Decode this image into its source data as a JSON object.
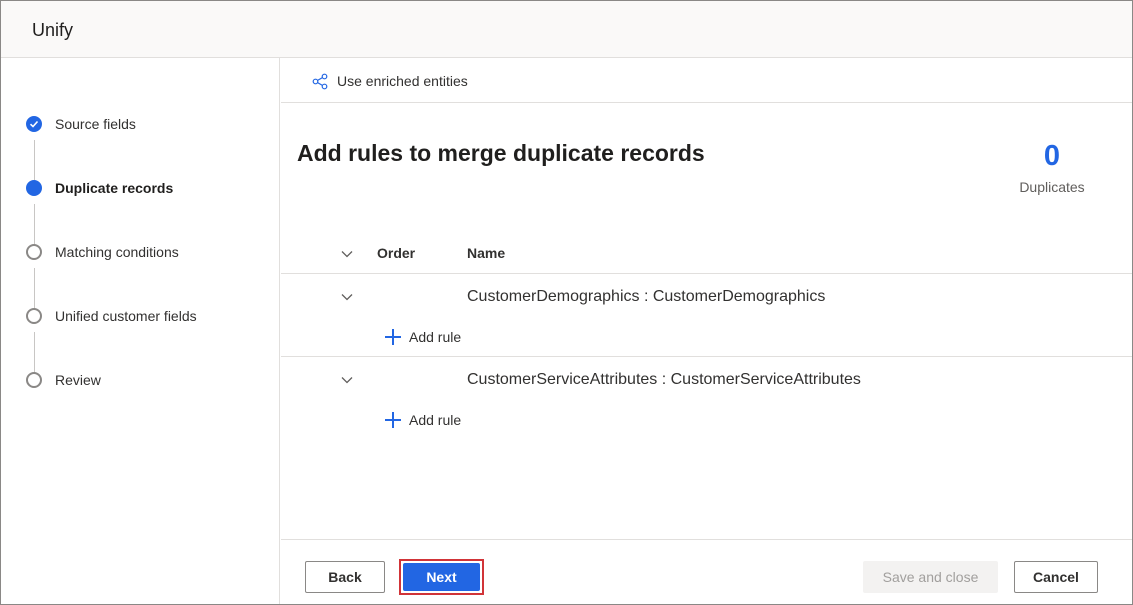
{
  "header": {
    "title": "Unify"
  },
  "steps": [
    {
      "label": "Source fields",
      "state": "done"
    },
    {
      "label": "Duplicate records",
      "state": "current"
    },
    {
      "label": "Matching conditions",
      "state": "todo"
    },
    {
      "label": "Unified customer fields",
      "state": "todo"
    },
    {
      "label": "Review",
      "state": "todo"
    }
  ],
  "cmdbar": {
    "use_enriched_label": "Use enriched entities",
    "icon": "share-nodes-icon"
  },
  "main": {
    "title": "Add rules to merge duplicate records",
    "duplicates_count": "0",
    "duplicates_label": "Duplicates"
  },
  "grid": {
    "columns": {
      "order": "Order",
      "name": "Name"
    },
    "groups": [
      {
        "name": "CustomerDemographics : CustomerDemographics",
        "add_rule_label": "Add rule"
      },
      {
        "name": "CustomerServiceAttributes : CustomerServiceAttributes",
        "add_rule_label": "Add rule"
      }
    ]
  },
  "footer": {
    "back_label": "Back",
    "next_label": "Next",
    "save_close_label": "Save and close",
    "cancel_label": "Cancel"
  },
  "colors": {
    "accent": "#2266e3",
    "highlight_border": "#d13438",
    "disabled_bg": "#f3f2f1"
  }
}
